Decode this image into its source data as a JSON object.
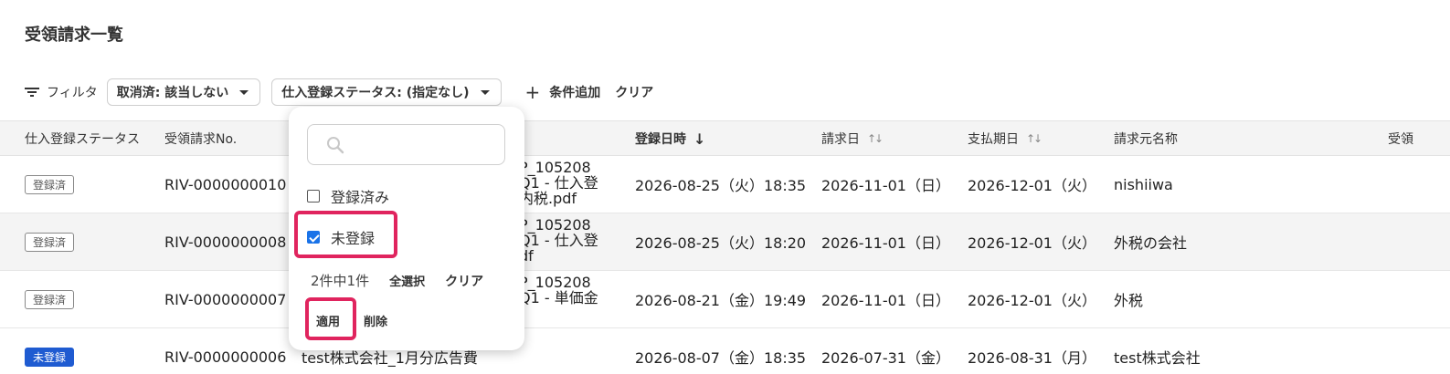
{
  "page": {
    "title": "受領請求一覧"
  },
  "filters": {
    "label": "フィルタ",
    "chips": [
      {
        "label": "取消済: 該当しない"
      },
      {
        "label": "仕入登録ステータス: (指定なし)"
      }
    ],
    "add_condition": "条件追加",
    "clear": "クリア"
  },
  "table": {
    "headers": [
      "仕入登録ステータス",
      "受領請求No.",
      "登録日時",
      "請求日",
      "支払期日",
      "請求元名称",
      "受領"
    ],
    "rows": [
      {
        "status": "登録済",
        "status_type": "registered",
        "no": "RIV-0000000010",
        "file": [
          "P_105208",
          "Q1 - 仕入登",
          "内税.pdf"
        ],
        "registered_at": "2026-08-25（火）18:35",
        "invoice_date": "2026-11-01（日）",
        "due_date": "2026-12-01（火）",
        "vendor": "nishiiwa"
      },
      {
        "status": "登録済",
        "status_type": "registered",
        "no": "RIV-0000000008",
        "file": [
          "P_105208",
          "Q1 - 仕入登",
          "df"
        ],
        "registered_at": "2026-08-25（火）18:20",
        "invoice_date": "2026-11-01（日）",
        "due_date": "2026-12-01（火）",
        "vendor": "外税の会社"
      },
      {
        "status": "登録済",
        "status_type": "registered",
        "no": "RIV-0000000007",
        "file": [
          "P_105208",
          "Q1 - 単価金"
        ],
        "registered_at": "2026-08-21（金）19:49",
        "invoice_date": "2026-11-01（日）",
        "due_date": "2026-12-01（火）",
        "vendor": "外税"
      },
      {
        "status": "未登録",
        "status_type": "unregistered",
        "no": "RIV-0000000006",
        "file": [
          "test株式会社_1月分広告費"
        ],
        "registered_at": "2026-08-07（金）18:35",
        "invoice_date": "2026-07-31（金）",
        "due_date": "2026-08-31（月）",
        "vendor": "test株式会社"
      }
    ]
  },
  "popover": {
    "search_placeholder": "",
    "options": [
      {
        "label": "登録済み",
        "checked": false
      },
      {
        "label": "未登録",
        "checked": true
      }
    ],
    "count": "2件中1件",
    "select_all": "全選択",
    "clear": "クリア",
    "apply": "適用",
    "delete": "削除"
  },
  "colors": {
    "accent": "#1a73e8",
    "badge_blue": "#1f5bd1",
    "highlight": "#e0245e"
  }
}
